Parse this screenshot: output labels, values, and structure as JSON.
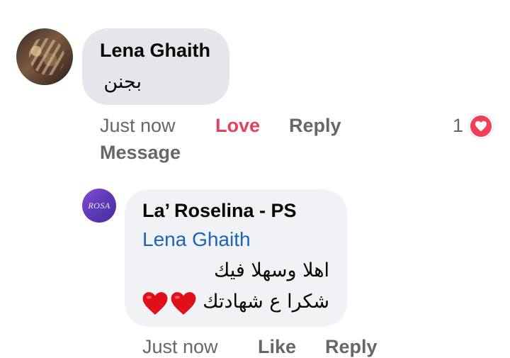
{
  "comments": [
    {
      "author": "Lena Ghaith",
      "text": "بجنن",
      "actions": {
        "time": "Just now",
        "love": "Love",
        "reply": "Reply",
        "message": "Message"
      },
      "reactions": {
        "count": "1",
        "type": "heart-reaction-icon"
      }
    }
  ],
  "reply": {
    "author": "La’ Roselina - PS",
    "avatar_text": "ROSA",
    "mention": "Lena Ghaith",
    "line1": "اهلا وسهلا فيك",
    "line2": "شكرا ع شهادتك",
    "actions": {
      "time": "Just now",
      "like": "Like",
      "reply": "Reply"
    }
  },
  "colors": {
    "love_red": "#e4405f",
    "mention_blue": "#1b65b5",
    "meta_gray": "#65676b",
    "heart": "#e0101a"
  }
}
